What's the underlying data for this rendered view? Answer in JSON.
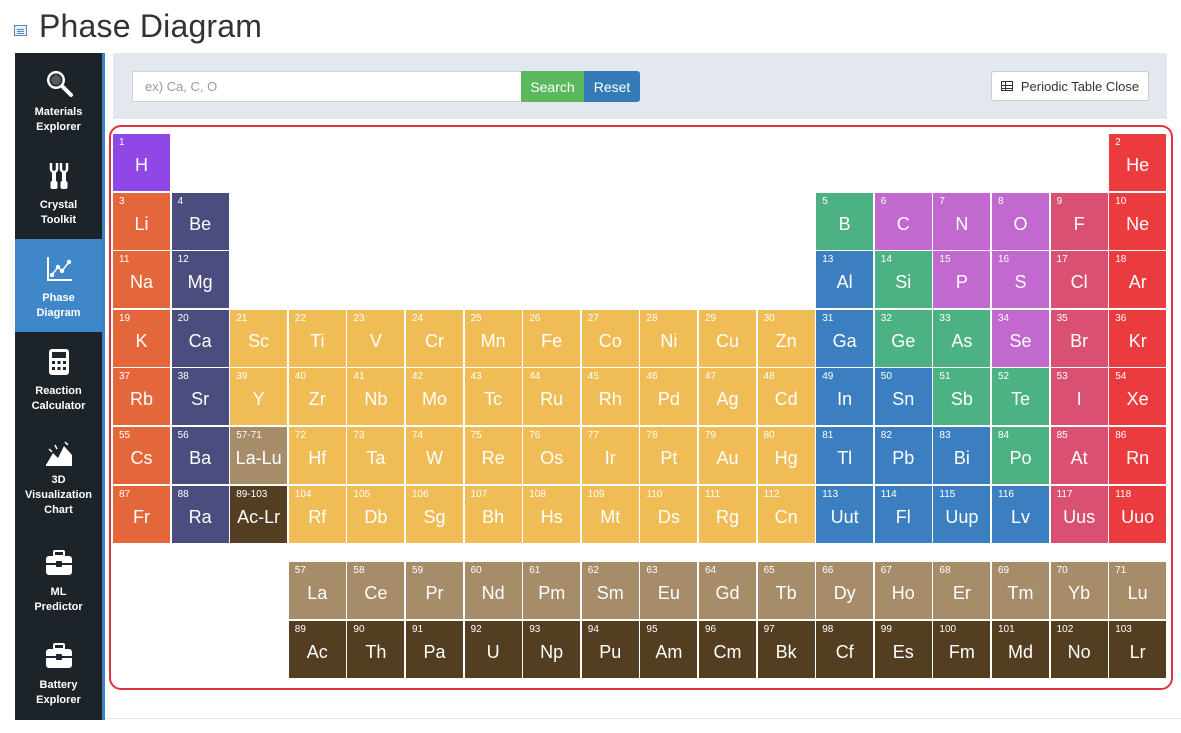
{
  "page": {
    "title": "Phase Diagram"
  },
  "sidebar": {
    "items": [
      {
        "label": "Materials\nExplorer",
        "icon": "magnifier-icon",
        "active": false
      },
      {
        "label": "Crystal\nToolkit",
        "icon": "tools-icon",
        "active": false
      },
      {
        "label": "Phase\nDiagram",
        "icon": "phase-chart-icon",
        "active": true
      },
      {
        "label": "Reaction\nCalculator",
        "icon": "calculator-icon",
        "active": false
      },
      {
        "label": "3D\nVisualization\nChart",
        "icon": "3d-chart-icon",
        "active": false
      },
      {
        "label": "ML\nPredictor",
        "icon": "toolbox-icon",
        "active": false
      },
      {
        "label": "Battery\nExplorer",
        "icon": "toolbox-icon",
        "active": false
      }
    ]
  },
  "search": {
    "placeholder": "ex) Ca, C, O",
    "value": "",
    "search_label": "Search",
    "reset_label": "Reset",
    "periodic_table_label": "Periodic Table Close"
  },
  "colors": {
    "nonmetal": "#8f47e6",
    "noble": "#ec3b3e",
    "alkali": "#e4673b",
    "alkaline": "#4a4d7d",
    "transition": "#f0bc55",
    "post_transition": "#3c7fc1",
    "metalloid": "#4cb284",
    "reactive_nonmetal": "#c269d0",
    "halogen": "#d95073",
    "lanthanide": "#a68c69",
    "actinide": "#543e22",
    "grid_gap": "#ffffff",
    "frame": "#e0323c",
    "sidebar_bg": "#1c2329",
    "sidebar_active": "#3f87c9",
    "toolbar_bg": "#e3e7ee"
  },
  "elements": [
    {
      "n": "1",
      "s": "H",
      "g": 1,
      "p": 1,
      "c": "nonmetal"
    },
    {
      "n": "2",
      "s": "He",
      "g": 18,
      "p": 1,
      "c": "noble"
    },
    {
      "n": "3",
      "s": "Li",
      "g": 1,
      "p": 2,
      "c": "alkali"
    },
    {
      "n": "4",
      "s": "Be",
      "g": 2,
      "p": 2,
      "c": "alkaline"
    },
    {
      "n": "5",
      "s": "B",
      "g": 13,
      "p": 2,
      "c": "metalloid"
    },
    {
      "n": "6",
      "s": "C",
      "g": 14,
      "p": 2,
      "c": "reactive_nonmetal"
    },
    {
      "n": "7",
      "s": "N",
      "g": 15,
      "p": 2,
      "c": "reactive_nonmetal"
    },
    {
      "n": "8",
      "s": "O",
      "g": 16,
      "p": 2,
      "c": "reactive_nonmetal"
    },
    {
      "n": "9",
      "s": "F",
      "g": 17,
      "p": 2,
      "c": "halogen"
    },
    {
      "n": "10",
      "s": "Ne",
      "g": 18,
      "p": 2,
      "c": "noble"
    },
    {
      "n": "11",
      "s": "Na",
      "g": 1,
      "p": 3,
      "c": "alkali"
    },
    {
      "n": "12",
      "s": "Mg",
      "g": 2,
      "p": 3,
      "c": "alkaline"
    },
    {
      "n": "13",
      "s": "Al",
      "g": 13,
      "p": 3,
      "c": "post_transition"
    },
    {
      "n": "14",
      "s": "Si",
      "g": 14,
      "p": 3,
      "c": "metalloid"
    },
    {
      "n": "15",
      "s": "P",
      "g": 15,
      "p": 3,
      "c": "reactive_nonmetal"
    },
    {
      "n": "16",
      "s": "S",
      "g": 16,
      "p": 3,
      "c": "reactive_nonmetal"
    },
    {
      "n": "17",
      "s": "Cl",
      "g": 17,
      "p": 3,
      "c": "halogen"
    },
    {
      "n": "18",
      "s": "Ar",
      "g": 18,
      "p": 3,
      "c": "noble"
    },
    {
      "n": "19",
      "s": "K",
      "g": 1,
      "p": 4,
      "c": "alkali"
    },
    {
      "n": "20",
      "s": "Ca",
      "g": 2,
      "p": 4,
      "c": "alkaline"
    },
    {
      "n": "21",
      "s": "Sc",
      "g": 3,
      "p": 4,
      "c": "transition"
    },
    {
      "n": "22",
      "s": "Ti",
      "g": 4,
      "p": 4,
      "c": "transition"
    },
    {
      "n": "23",
      "s": "V",
      "g": 5,
      "p": 4,
      "c": "transition"
    },
    {
      "n": "24",
      "s": "Cr",
      "g": 6,
      "p": 4,
      "c": "transition"
    },
    {
      "n": "25",
      "s": "Mn",
      "g": 7,
      "p": 4,
      "c": "transition"
    },
    {
      "n": "26",
      "s": "Fe",
      "g": 8,
      "p": 4,
      "c": "transition"
    },
    {
      "n": "27",
      "s": "Co",
      "g": 9,
      "p": 4,
      "c": "transition"
    },
    {
      "n": "28",
      "s": "Ni",
      "g": 10,
      "p": 4,
      "c": "transition"
    },
    {
      "n": "29",
      "s": "Cu",
      "g": 11,
      "p": 4,
      "c": "transition"
    },
    {
      "n": "30",
      "s": "Zn",
      "g": 12,
      "p": 4,
      "c": "transition"
    },
    {
      "n": "31",
      "s": "Ga",
      "g": 13,
      "p": 4,
      "c": "post_transition"
    },
    {
      "n": "32",
      "s": "Ge",
      "g": 14,
      "p": 4,
      "c": "metalloid"
    },
    {
      "n": "33",
      "s": "As",
      "g": 15,
      "p": 4,
      "c": "metalloid"
    },
    {
      "n": "34",
      "s": "Se",
      "g": 16,
      "p": 4,
      "c": "reactive_nonmetal"
    },
    {
      "n": "35",
      "s": "Br",
      "g": 17,
      "p": 4,
      "c": "halogen"
    },
    {
      "n": "36",
      "s": "Kr",
      "g": 18,
      "p": 4,
      "c": "noble"
    },
    {
      "n": "37",
      "s": "Rb",
      "g": 1,
      "p": 5,
      "c": "alkali"
    },
    {
      "n": "38",
      "s": "Sr",
      "g": 2,
      "p": 5,
      "c": "alkaline"
    },
    {
      "n": "39",
      "s": "Y",
      "g": 3,
      "p": 5,
      "c": "transition"
    },
    {
      "n": "40",
      "s": "Zr",
      "g": 4,
      "p": 5,
      "c": "transition"
    },
    {
      "n": "41",
      "s": "Nb",
      "g": 5,
      "p": 5,
      "c": "transition"
    },
    {
      "n": "42",
      "s": "Mo",
      "g": 6,
      "p": 5,
      "c": "transition"
    },
    {
      "n": "43",
      "s": "Tc",
      "g": 7,
      "p": 5,
      "c": "transition"
    },
    {
      "n": "44",
      "s": "Ru",
      "g": 8,
      "p": 5,
      "c": "transition"
    },
    {
      "n": "45",
      "s": "Rh",
      "g": 9,
      "p": 5,
      "c": "transition"
    },
    {
      "n": "46",
      "s": "Pd",
      "g": 10,
      "p": 5,
      "c": "transition"
    },
    {
      "n": "47",
      "s": "Ag",
      "g": 11,
      "p": 5,
      "c": "transition"
    },
    {
      "n": "48",
      "s": "Cd",
      "g": 12,
      "p": 5,
      "c": "transition"
    },
    {
      "n": "49",
      "s": "In",
      "g": 13,
      "p": 5,
      "c": "post_transition"
    },
    {
      "n": "50",
      "s": "Sn",
      "g": 14,
      "p": 5,
      "c": "post_transition"
    },
    {
      "n": "51",
      "s": "Sb",
      "g": 15,
      "p": 5,
      "c": "metalloid"
    },
    {
      "n": "52",
      "s": "Te",
      "g": 16,
      "p": 5,
      "c": "metalloid"
    },
    {
      "n": "53",
      "s": "I",
      "g": 17,
      "p": 5,
      "c": "halogen"
    },
    {
      "n": "54",
      "s": "Xe",
      "g": 18,
      "p": 5,
      "c": "noble"
    },
    {
      "n": "55",
      "s": "Cs",
      "g": 1,
      "p": 6,
      "c": "alkali"
    },
    {
      "n": "56",
      "s": "Ba",
      "g": 2,
      "p": 6,
      "c": "alkaline"
    },
    {
      "n": "57-71",
      "s": "La-Lu",
      "g": 3,
      "p": 6,
      "c": "lanthanide"
    },
    {
      "n": "72",
      "s": "Hf",
      "g": 4,
      "p": 6,
      "c": "transition"
    },
    {
      "n": "73",
      "s": "Ta",
      "g": 5,
      "p": 6,
      "c": "transition"
    },
    {
      "n": "74",
      "s": "W",
      "g": 6,
      "p": 6,
      "c": "transition"
    },
    {
      "n": "75",
      "s": "Re",
      "g": 7,
      "p": 6,
      "c": "transition"
    },
    {
      "n": "76",
      "s": "Os",
      "g": 8,
      "p": 6,
      "c": "transition"
    },
    {
      "n": "77",
      "s": "Ir",
      "g": 9,
      "p": 6,
      "c": "transition"
    },
    {
      "n": "78",
      "s": "Pt",
      "g": 10,
      "p": 6,
      "c": "transition"
    },
    {
      "n": "79",
      "s": "Au",
      "g": 11,
      "p": 6,
      "c": "transition"
    },
    {
      "n": "80",
      "s": "Hg",
      "g": 12,
      "p": 6,
      "c": "transition"
    },
    {
      "n": "81",
      "s": "Tl",
      "g": 13,
      "p": 6,
      "c": "post_transition"
    },
    {
      "n": "82",
      "s": "Pb",
      "g": 14,
      "p": 6,
      "c": "post_transition"
    },
    {
      "n": "83",
      "s": "Bi",
      "g": 15,
      "p": 6,
      "c": "post_transition"
    },
    {
      "n": "84",
      "s": "Po",
      "g": 16,
      "p": 6,
      "c": "metalloid"
    },
    {
      "n": "85",
      "s": "At",
      "g": 17,
      "p": 6,
      "c": "halogen"
    },
    {
      "n": "86",
      "s": "Rn",
      "g": 18,
      "p": 6,
      "c": "noble"
    },
    {
      "n": "87",
      "s": "Fr",
      "g": 1,
      "p": 7,
      "c": "alkali"
    },
    {
      "n": "88",
      "s": "Ra",
      "g": 2,
      "p": 7,
      "c": "alkaline"
    },
    {
      "n": "89-103",
      "s": "Ac-Lr",
      "g": 3,
      "p": 7,
      "c": "actinide"
    },
    {
      "n": "104",
      "s": "Rf",
      "g": 4,
      "p": 7,
      "c": "transition"
    },
    {
      "n": "105",
      "s": "Db",
      "g": 5,
      "p": 7,
      "c": "transition"
    },
    {
      "n": "106",
      "s": "Sg",
      "g": 6,
      "p": 7,
      "c": "transition"
    },
    {
      "n": "107",
      "s": "Bh",
      "g": 7,
      "p": 7,
      "c": "transition"
    },
    {
      "n": "108",
      "s": "Hs",
      "g": 8,
      "p": 7,
      "c": "transition"
    },
    {
      "n": "109",
      "s": "Mt",
      "g": 9,
      "p": 7,
      "c": "transition"
    },
    {
      "n": "110",
      "s": "Ds",
      "g": 10,
      "p": 7,
      "c": "transition"
    },
    {
      "n": "111",
      "s": "Rg",
      "g": 11,
      "p": 7,
      "c": "transition"
    },
    {
      "n": "112",
      "s": "Cn",
      "g": 12,
      "p": 7,
      "c": "transition"
    },
    {
      "n": "113",
      "s": "Uut",
      "g": 13,
      "p": 7,
      "c": "post_transition"
    },
    {
      "n": "114",
      "s": "Fl",
      "g": 14,
      "p": 7,
      "c": "post_transition"
    },
    {
      "n": "115",
      "s": "Uup",
      "g": 15,
      "p": 7,
      "c": "post_transition"
    },
    {
      "n": "116",
      "s": "Lv",
      "g": 16,
      "p": 7,
      "c": "post_transition"
    },
    {
      "n": "117",
      "s": "Uus",
      "g": 17,
      "p": 7,
      "c": "halogen"
    },
    {
      "n": "118",
      "s": "Uuo",
      "g": 18,
      "p": 7,
      "c": "noble"
    },
    {
      "n": "57",
      "s": "La",
      "g": 4,
      "p": 9,
      "c": "lanthanide"
    },
    {
      "n": "58",
      "s": "Ce",
      "g": 5,
      "p": 9,
      "c": "lanthanide"
    },
    {
      "n": "59",
      "s": "Pr",
      "g": 6,
      "p": 9,
      "c": "lanthanide"
    },
    {
      "n": "60",
      "s": "Nd",
      "g": 7,
      "p": 9,
      "c": "lanthanide"
    },
    {
      "n": "61",
      "s": "Pm",
      "g": 8,
      "p": 9,
      "c": "lanthanide"
    },
    {
      "n": "62",
      "s": "Sm",
      "g": 9,
      "p": 9,
      "c": "lanthanide"
    },
    {
      "n": "63",
      "s": "Eu",
      "g": 10,
      "p": 9,
      "c": "lanthanide"
    },
    {
      "n": "64",
      "s": "Gd",
      "g": 11,
      "p": 9,
      "c": "lanthanide"
    },
    {
      "n": "65",
      "s": "Tb",
      "g": 12,
      "p": 9,
      "c": "lanthanide"
    },
    {
      "n": "66",
      "s": "Dy",
      "g": 13,
      "p": 9,
      "c": "lanthanide"
    },
    {
      "n": "67",
      "s": "Ho",
      "g": 14,
      "p": 9,
      "c": "lanthanide"
    },
    {
      "n": "68",
      "s": "Er",
      "g": 15,
      "p": 9,
      "c": "lanthanide"
    },
    {
      "n": "69",
      "s": "Tm",
      "g": 16,
      "p": 9,
      "c": "lanthanide"
    },
    {
      "n": "70",
      "s": "Yb",
      "g": 17,
      "p": 9,
      "c": "lanthanide"
    },
    {
      "n": "71",
      "s": "Lu",
      "g": 18,
      "p": 9,
      "c": "lanthanide"
    },
    {
      "n": "89",
      "s": "Ac",
      "g": 4,
      "p": 10,
      "c": "actinide"
    },
    {
      "n": "90",
      "s": "Th",
      "g": 5,
      "p": 10,
      "c": "actinide"
    },
    {
      "n": "91",
      "s": "Pa",
      "g": 6,
      "p": 10,
      "c": "actinide"
    },
    {
      "n": "92",
      "s": "U",
      "g": 7,
      "p": 10,
      "c": "actinide"
    },
    {
      "n": "93",
      "s": "Np",
      "g": 8,
      "p": 10,
      "c": "actinide"
    },
    {
      "n": "94",
      "s": "Pu",
      "g": 9,
      "p": 10,
      "c": "actinide"
    },
    {
      "n": "95",
      "s": "Am",
      "g": 10,
      "p": 10,
      "c": "actinide"
    },
    {
      "n": "96",
      "s": "Cm",
      "g": 11,
      "p": 10,
      "c": "actinide"
    },
    {
      "n": "97",
      "s": "Bk",
      "g": 12,
      "p": 10,
      "c": "actinide"
    },
    {
      "n": "98",
      "s": "Cf",
      "g": 13,
      "p": 10,
      "c": "actinide"
    },
    {
      "n": "99",
      "s": "Es",
      "g": 14,
      "p": 10,
      "c": "actinide"
    },
    {
      "n": "100",
      "s": "Fm",
      "g": 15,
      "p": 10,
      "c": "actinide"
    },
    {
      "n": "101",
      "s": "Md",
      "g": 16,
      "p": 10,
      "c": "actinide"
    },
    {
      "n": "102",
      "s": "No",
      "g": 17,
      "p": 10,
      "c": "actinide"
    },
    {
      "n": "103",
      "s": "Lr",
      "g": 18,
      "p": 10,
      "c": "actinide"
    }
  ]
}
